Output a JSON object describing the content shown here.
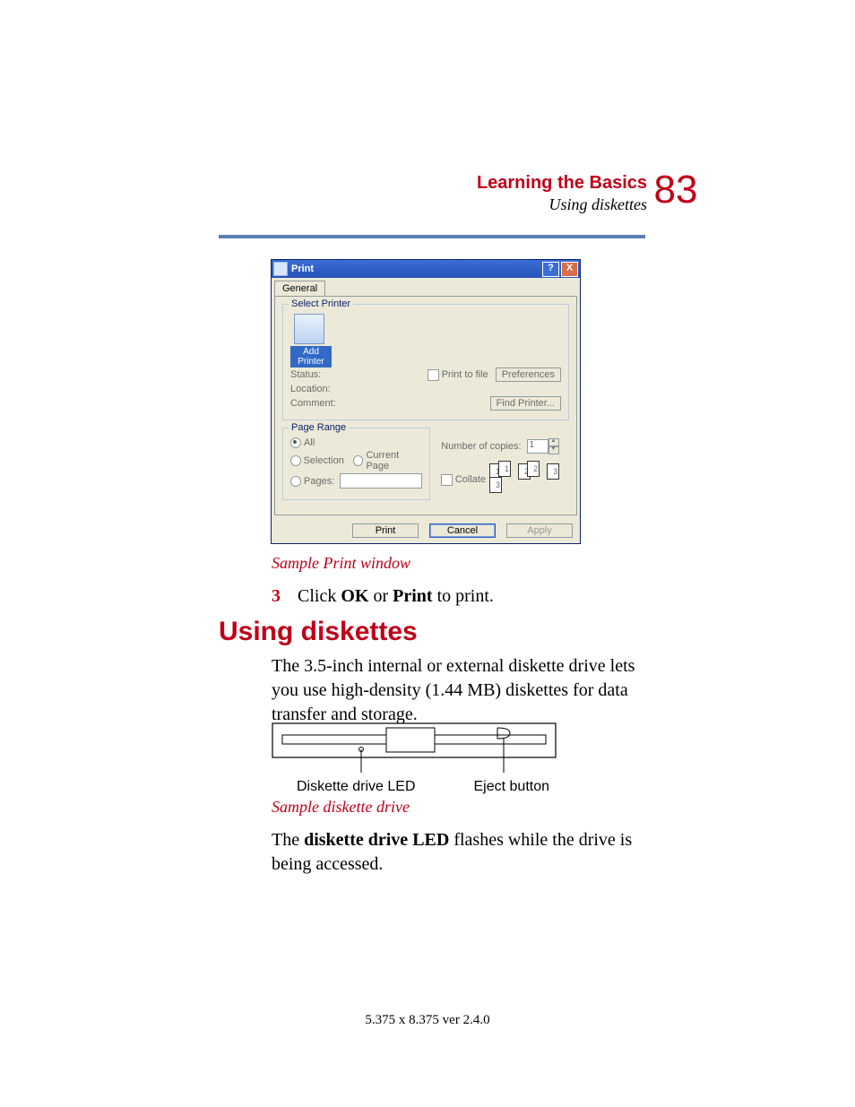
{
  "header": {
    "chapter": "Learning the Basics",
    "sub": "Using diskettes",
    "page": "83"
  },
  "dialog": {
    "title": "Print",
    "tab": "General",
    "group_select": "Select Printer",
    "add_printer": "Add Printer",
    "status_label": "Status:",
    "location_label": "Location:",
    "comment_label": "Comment:",
    "print_to_file": "Print to file",
    "preferences": "Preferences",
    "find_printer": "Find Printer...",
    "group_range": "Page Range",
    "opt_all": "All",
    "opt_selection": "Selection",
    "opt_current": "Current Page",
    "opt_pages": "Pages:",
    "copies_label": "Number of copies:",
    "copies_value": "1",
    "collate": "Collate",
    "btn_print": "Print",
    "btn_cancel": "Cancel",
    "btn_apply": "Apply"
  },
  "caption1": "Sample Print window",
  "step": {
    "num": "3",
    "text_a": "Click ",
    "ok": "OK",
    "text_b": " or ",
    "pr": "Print",
    "text_c": " to print."
  },
  "h1": "Using diskettes",
  "para1": "The 3.5-inch internal or external diskette drive lets you use high-density (1.44 MB) diskettes for data transfer and storage.",
  "drive": {
    "led": "Diskette drive LED",
    "eject": "Eject button"
  },
  "caption2": "Sample diskette drive",
  "para2a": "The ",
  "para2b": "diskette drive LED",
  "para2c": " flashes while the drive is being accessed.",
  "footer": "5.375 x 8.375 ver 2.4.0"
}
